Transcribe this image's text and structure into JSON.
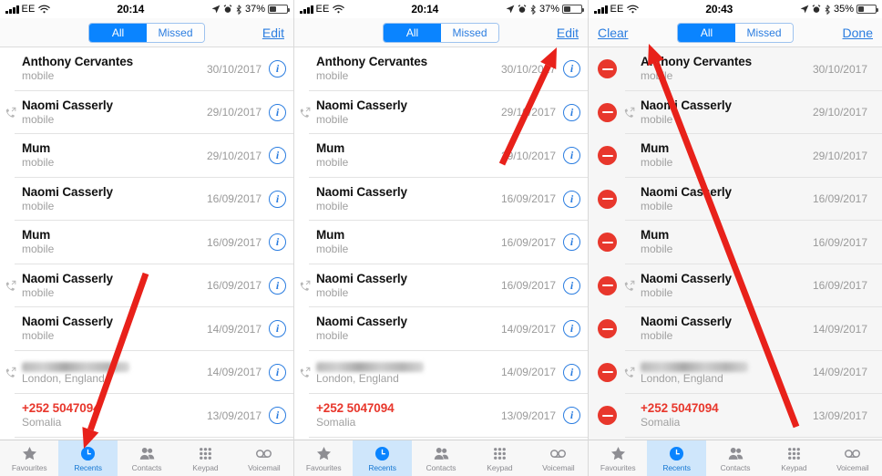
{
  "app": {
    "name": "Phone",
    "screen": "Recents"
  },
  "colors": {
    "accent_blue": "#0a84ff",
    "link_blue": "#2b7de0",
    "delete_red": "#e8372c",
    "annotation_red": "#e8211a",
    "tab_selected_bg": "#cfe6fb"
  },
  "panels": [
    {
      "id": "panel-recents-normal",
      "status": {
        "carrier": "EE",
        "time": "20:14",
        "battery_percent": "37%",
        "battery_level": 37
      },
      "nav": {
        "left_label": "",
        "right_label": "Edit",
        "has_left": false
      },
      "segmented": {
        "options": [
          "All",
          "Missed"
        ],
        "selected": "All"
      },
      "edit_mode": false,
      "rows": [
        {
          "name": "Anthony Cervantes",
          "sub": "mobile",
          "date": "30/10/2017",
          "direction": "incoming",
          "missed": false,
          "redacted": false
        },
        {
          "name": "Naomi Casserly",
          "sub": "mobile",
          "date": "29/10/2017",
          "direction": "outgoing",
          "missed": false,
          "redacted": false
        },
        {
          "name": "Mum",
          "sub": "mobile",
          "date": "29/10/2017",
          "direction": "incoming",
          "missed": false,
          "redacted": false
        },
        {
          "name": "Naomi Casserly",
          "sub": "mobile",
          "date": "16/09/2017",
          "direction": "incoming",
          "missed": false,
          "redacted": false
        },
        {
          "name": "Mum",
          "sub": "mobile",
          "date": "16/09/2017",
          "direction": "incoming",
          "missed": false,
          "redacted": false
        },
        {
          "name": "Naomi Casserly",
          "sub": "mobile",
          "date": "16/09/2017",
          "direction": "outgoing",
          "missed": false,
          "redacted": false
        },
        {
          "name": "Naomi Casserly",
          "sub": "mobile",
          "date": "14/09/2017",
          "direction": "incoming",
          "missed": false,
          "redacted": false
        },
        {
          "name": "",
          "sub": "London, England",
          "date": "14/09/2017",
          "direction": "outgoing",
          "missed": false,
          "redacted": true
        },
        {
          "name": "+252 5047094",
          "sub": "Somalia",
          "date": "13/09/2017",
          "direction": "incoming",
          "missed": true,
          "redacted": false
        }
      ],
      "tabs": [
        {
          "label": "Favourites",
          "icon": "star-icon",
          "active": false
        },
        {
          "label": "Recents",
          "icon": "clock-icon",
          "active": true
        },
        {
          "label": "Contacts",
          "icon": "people-icon",
          "active": false
        },
        {
          "label": "Keypad",
          "icon": "keypad-icon",
          "active": false
        },
        {
          "label": "Voicemail",
          "icon": "voicemail-icon",
          "active": false
        }
      ],
      "annotation": {
        "type": "arrow",
        "points_to": "Recents tab"
      }
    },
    {
      "id": "panel-recents-edit-target",
      "status": {
        "carrier": "EE",
        "time": "20:14",
        "battery_percent": "37%",
        "battery_level": 37
      },
      "nav": {
        "left_label": "",
        "right_label": "Edit",
        "has_left": false
      },
      "segmented": {
        "options": [
          "All",
          "Missed"
        ],
        "selected": "All"
      },
      "edit_mode": false,
      "rows": [
        {
          "name": "Anthony Cervantes",
          "sub": "mobile",
          "date": "30/10/2017",
          "direction": "incoming",
          "missed": false,
          "redacted": false
        },
        {
          "name": "Naomi Casserly",
          "sub": "mobile",
          "date": "29/10/2017",
          "direction": "outgoing",
          "missed": false,
          "redacted": false
        },
        {
          "name": "Mum",
          "sub": "mobile",
          "date": "29/10/2017",
          "direction": "incoming",
          "missed": false,
          "redacted": false
        },
        {
          "name": "Naomi Casserly",
          "sub": "mobile",
          "date": "16/09/2017",
          "direction": "incoming",
          "missed": false,
          "redacted": false
        },
        {
          "name": "Mum",
          "sub": "mobile",
          "date": "16/09/2017",
          "direction": "incoming",
          "missed": false,
          "redacted": false
        },
        {
          "name": "Naomi Casserly",
          "sub": "mobile",
          "date": "16/09/2017",
          "direction": "outgoing",
          "missed": false,
          "redacted": false
        },
        {
          "name": "Naomi Casserly",
          "sub": "mobile",
          "date": "14/09/2017",
          "direction": "incoming",
          "missed": false,
          "redacted": false
        },
        {
          "name": "",
          "sub": "London, England",
          "date": "14/09/2017",
          "direction": "outgoing",
          "missed": false,
          "redacted": true
        },
        {
          "name": "+252 5047094",
          "sub": "Somalia",
          "date": "13/09/2017",
          "direction": "incoming",
          "missed": true,
          "redacted": false
        }
      ],
      "tabs": [
        {
          "label": "Favourites",
          "icon": "star-icon",
          "active": false
        },
        {
          "label": "Recents",
          "icon": "clock-icon",
          "active": true
        },
        {
          "label": "Contacts",
          "icon": "people-icon",
          "active": false
        },
        {
          "label": "Keypad",
          "icon": "keypad-icon",
          "active": false
        },
        {
          "label": "Voicemail",
          "icon": "voicemail-icon",
          "active": false
        }
      ],
      "annotation": {
        "type": "arrow",
        "points_to": "Edit button"
      }
    },
    {
      "id": "panel-recents-editing",
      "status": {
        "carrier": "EE",
        "time": "20:43",
        "battery_percent": "35%",
        "battery_level": 35
      },
      "nav": {
        "left_label": "Clear",
        "right_label": "Done",
        "has_left": true
      },
      "segmented": {
        "options": [
          "All",
          "Missed"
        ],
        "selected": "All"
      },
      "edit_mode": true,
      "rows": [
        {
          "name": "Anthony Cervantes",
          "sub": "mobile",
          "date": "30/10/2017",
          "direction": "incoming",
          "missed": false,
          "redacted": false
        },
        {
          "name": "Naomi Casserly",
          "sub": "mobile",
          "date": "29/10/2017",
          "direction": "outgoing",
          "missed": false,
          "redacted": false
        },
        {
          "name": "Mum",
          "sub": "mobile",
          "date": "29/10/2017",
          "direction": "incoming",
          "missed": false,
          "redacted": false
        },
        {
          "name": "Naomi Casserly",
          "sub": "mobile",
          "date": "16/09/2017",
          "direction": "incoming",
          "missed": false,
          "redacted": false
        },
        {
          "name": "Mum",
          "sub": "mobile",
          "date": "16/09/2017",
          "direction": "incoming",
          "missed": false,
          "redacted": false
        },
        {
          "name": "Naomi Casserly",
          "sub": "mobile",
          "date": "16/09/2017",
          "direction": "outgoing",
          "missed": false,
          "redacted": false
        },
        {
          "name": "Naomi Casserly",
          "sub": "mobile",
          "date": "14/09/2017",
          "direction": "incoming",
          "missed": false,
          "redacted": false
        },
        {
          "name": "",
          "sub": "London, England",
          "date": "14/09/2017",
          "direction": "outgoing",
          "missed": false,
          "redacted": true
        },
        {
          "name": "+252 5047094",
          "sub": "Somalia",
          "date": "13/09/2017",
          "direction": "incoming",
          "missed": true,
          "redacted": false
        }
      ],
      "tabs": [
        {
          "label": "Favourites",
          "icon": "star-icon",
          "active": false
        },
        {
          "label": "Recents",
          "icon": "clock-icon",
          "active": true
        },
        {
          "label": "Contacts",
          "icon": "people-icon",
          "active": false
        },
        {
          "label": "Keypad",
          "icon": "keypad-icon",
          "active": false
        },
        {
          "label": "Voicemail",
          "icon": "voicemail-icon",
          "active": false
        }
      ],
      "annotation": {
        "type": "arrow",
        "points_to": "Clear button"
      }
    }
  ]
}
